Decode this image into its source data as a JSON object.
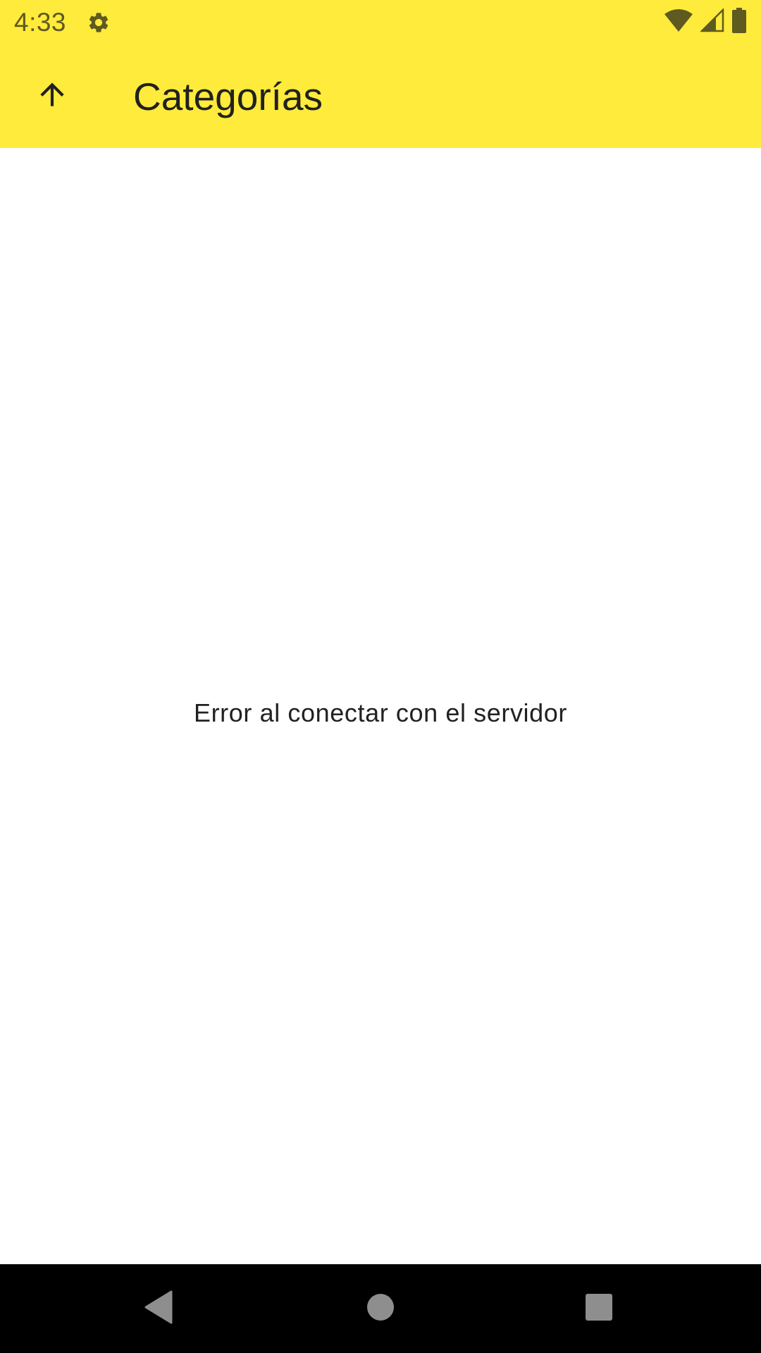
{
  "status_bar": {
    "time": "4:33",
    "icons": [
      "settings-icon",
      "wifi-icon",
      "cell-signal-icon",
      "battery-icon"
    ]
  },
  "app_bar": {
    "title": "Categorías",
    "up_icon": "arrow-up-icon",
    "background_color": "#FFEB3B"
  },
  "main": {
    "message": "Error al conectar con el servidor"
  },
  "nav_bar": {
    "buttons": [
      "back-icon",
      "home-icon",
      "recents-icon"
    ],
    "background_color": "#000000"
  }
}
